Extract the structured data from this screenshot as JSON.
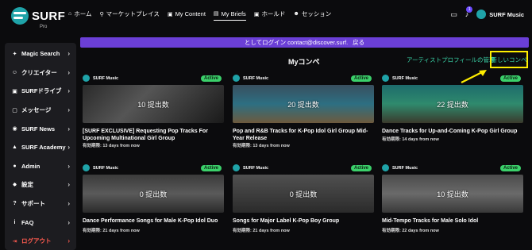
{
  "logo": {
    "name": "SURF",
    "sub": "Pro"
  },
  "nav": [
    {
      "icon": "home-icon",
      "glyph": "⌂",
      "label": "ホーム"
    },
    {
      "icon": "search-icon",
      "glyph": "⚲",
      "label": "マーケットプレイス"
    },
    {
      "icon": "folder-icon",
      "glyph": "▣",
      "label": "My Content"
    },
    {
      "icon": "document-icon",
      "glyph": "▤",
      "label": "My Briefs"
    },
    {
      "icon": "lock-icon",
      "glyph": "▣",
      "label": "ホールド"
    },
    {
      "icon": "users-icon",
      "glyph": "☻",
      "label": "セッション"
    }
  ],
  "topright": {
    "notification_count": "1",
    "user_name": "SURF Music"
  },
  "sidebar": [
    {
      "icon": "magic-icon",
      "glyph": "✦",
      "label": "Magic Search"
    },
    {
      "icon": "users-icon",
      "glyph": "☺",
      "label": "クリエイター"
    },
    {
      "icon": "drive-icon",
      "glyph": "▣",
      "label": "SURFドライブ"
    },
    {
      "icon": "message-icon",
      "glyph": "▢",
      "label": "メッセージ"
    },
    {
      "icon": "globe-icon",
      "glyph": "◉",
      "label": "SURF News"
    },
    {
      "icon": "academy-icon",
      "glyph": "▲",
      "label": "SURF Academy"
    },
    {
      "icon": "admin-icon",
      "glyph": "●",
      "label": "Admin"
    },
    {
      "icon": "settings-icon",
      "glyph": "✸",
      "label": "設定"
    },
    {
      "icon": "help-icon",
      "glyph": "?",
      "label": "サポート"
    },
    {
      "icon": "info-icon",
      "glyph": "i",
      "label": "FAQ"
    },
    {
      "icon": "logout-icon",
      "glyph": "⇥",
      "label": "ログアウト"
    }
  ],
  "banner": {
    "text": "としてログイン contact@discover.surf.",
    "back": "戻る"
  },
  "page": {
    "title": "Myコンペ",
    "manage_link": "アーティストプロフィールの管理",
    "new_button": "新しいコンペ"
  },
  "cards": [
    {
      "brand": "SURF Music",
      "status": "Active",
      "submissions": "10 提出数",
      "title": "[SURF EXCLUSIVE] Requesting Pop Tracks For Upcoming Multinational Girl Group",
      "deadline": "有効期限: 13 days from now"
    },
    {
      "brand": "SURF Music",
      "status": "Active",
      "submissions": "20 提出数",
      "title": "Pop and R&B Tracks for K-Pop Idol Girl Group Mid-Year Release",
      "deadline": "有効期限: 13 days from now"
    },
    {
      "brand": "SURF Music",
      "status": "Active",
      "submissions": "22 提出数",
      "title": "Dance Tracks for Up-and-Coming K-Pop Girl Group",
      "deadline": "有効期限: 14 days from now"
    },
    {
      "brand": "SURF Music",
      "status": "Active",
      "submissions": "0 提出数",
      "title": "Dance Performance Songs for Male K-Pop Idol Duo",
      "deadline": "有効期限: 21 days from now"
    },
    {
      "brand": "SURF Music",
      "status": "Active",
      "submissions": "0 提出数",
      "title": "Songs for Major Label K-Pop Boy Group",
      "deadline": "有効期限: 21 days from now"
    },
    {
      "brand": "SURF Music",
      "status": "Active",
      "submissions": "10 提出数",
      "title": "Mid-Tempo Tracks for Male Solo Idol",
      "deadline": "有効期限: 22 days from now"
    }
  ],
  "colors": {
    "accent": "#6b3fd6",
    "teal": "#39d0a5",
    "highlight": "#ffee00",
    "active_badge": "#3bd06a",
    "logout": "#ff5b4f"
  }
}
